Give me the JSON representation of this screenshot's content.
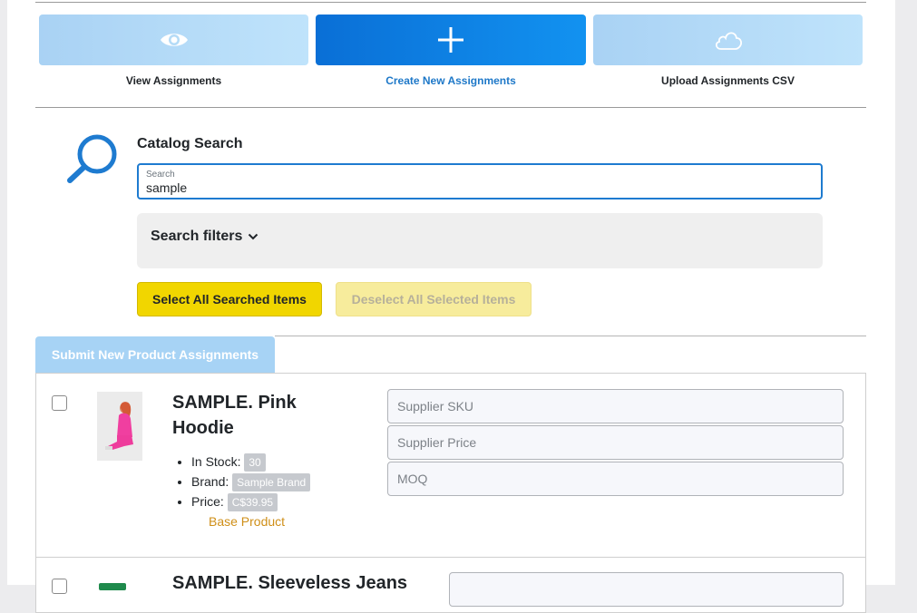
{
  "actions": [
    {
      "label": "View Assignments",
      "icon": "eye-icon"
    },
    {
      "label": "Create New Assignments",
      "icon": "plus-icon"
    },
    {
      "label": "Upload Assignments CSV",
      "icon": "cloud-icon"
    }
  ],
  "catalog": {
    "title": "Catalog Search",
    "search_label": "Search",
    "search_value": "sample",
    "filters_label": "Search filters"
  },
  "buttons": {
    "select_all": "Select All Searched Items",
    "deselect_all": "Deselect All Selected Items",
    "submit": "Submit New Product Assignments"
  },
  "products": [
    {
      "name_line1": "SAMPLE. Pink",
      "name_line2": "Hoodie",
      "stock_label": "In Stock:",
      "stock": "30",
      "brand_label": "Brand:",
      "brand": "Sample Brand",
      "price_label": "Price:",
      "price": "C$39.95",
      "type": "Base Product",
      "fields": {
        "sku": "Supplier SKU",
        "price": "Supplier Price",
        "moq": "MOQ"
      }
    },
    {
      "name_line1": "SAMPLE. Sleeveless Jeans"
    }
  ],
  "colors": {
    "accent": "#1e7bd0",
    "select_button": "#f1d600",
    "base_product": "#cf8f18"
  }
}
